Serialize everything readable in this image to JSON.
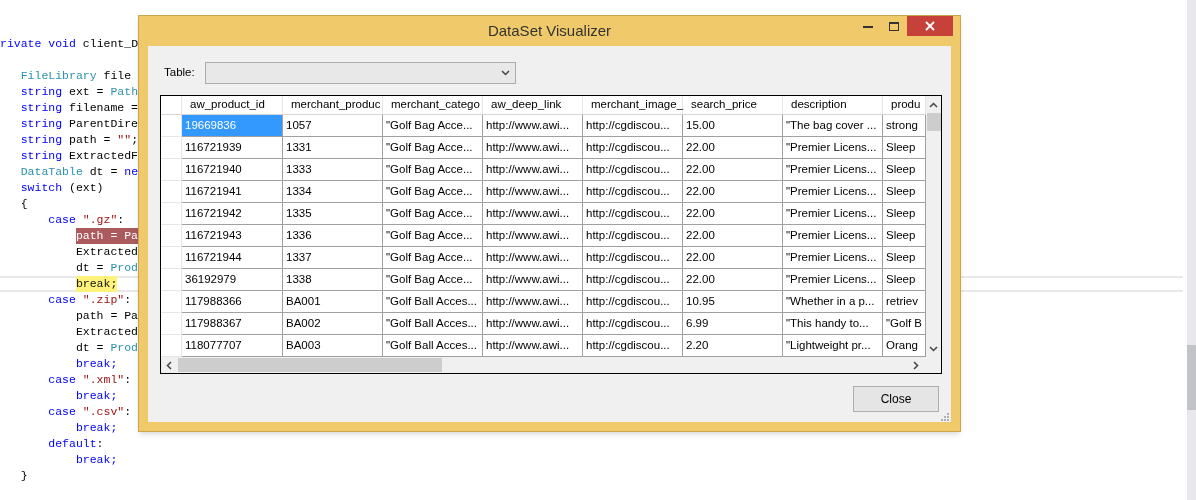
{
  "editor": {
    "lines": [
      {
        "tokens": [
          {
            "kind": "keyword",
            "text": "rivate void"
          },
          {
            "kind": "plain",
            "text": " client_D"
          }
        ],
        "children": [
          {
            "gap_before": true,
            "tokens": [
              {
                "kind": "type",
                "text": "FileLibrary"
              },
              {
                "kind": "plain",
                "text": " file"
              }
            ]
          },
          {
            "tokens": [
              {
                "kind": "keyword",
                "text": "string"
              },
              {
                "kind": "plain",
                "text": " ext = "
              },
              {
                "kind": "type",
                "text": "Path"
              }
            ]
          },
          {
            "tokens": [
              {
                "kind": "keyword",
                "text": "string"
              },
              {
                "kind": "plain",
                "text": " filename ="
              }
            ]
          },
          {
            "tokens": [
              {
                "kind": "keyword",
                "text": "string"
              },
              {
                "kind": "plain",
                "text": " ParentDire"
              }
            ]
          },
          {
            "tokens": [
              {
                "kind": "keyword",
                "text": "string"
              },
              {
                "kind": "plain",
                "text": " path = "
              },
              {
                "kind": "string",
                "text": "\"\""
              },
              {
                "kind": "plain",
                "text": ";"
              }
            ]
          },
          {
            "tokens": [
              {
                "kind": "keyword",
                "text": "string"
              },
              {
                "kind": "plain",
                "text": " ExtractedF"
              }
            ]
          },
          {
            "tokens": [
              {
                "kind": "type",
                "text": "DataTable"
              },
              {
                "kind": "plain",
                "text": " dt = "
              },
              {
                "kind": "keyword",
                "text": "ne"
              }
            ]
          },
          {
            "tokens": [
              {
                "kind": "keyword",
                "text": "switch"
              },
              {
                "kind": "plain",
                "text": " (ext)"
              }
            ]
          },
          {
            "tokens": [
              {
                "kind": "plain",
                "text": "{"
              }
            ],
            "children": [
              {
                "tokens": [
                  {
                    "kind": "keyword",
                    "text": "case"
                  },
                  {
                    "kind": "string",
                    "text": " \".gz\""
                  },
                  {
                    "kind": "plain",
                    "text": ":"
                  }
                ],
                "children": [
                  {
                    "breakpoint": true,
                    "tokens": [
                      {
                        "kind": "plain",
                        "text": "path = Pa"
                      }
                    ]
                  },
                  {
                    "tokens": [
                      {
                        "kind": "plain",
                        "text": "Extracted"
                      }
                    ]
                  },
                  {
                    "tokens": [
                      {
                        "kind": "plain",
                        "text": "dt = "
                      },
                      {
                        "kind": "type",
                        "text": "Prod"
                      }
                    ]
                  },
                  {
                    "current_statement": true,
                    "tokens": [
                      {
                        "kind": "keyword",
                        "text": "break;"
                      }
                    ]
                  }
                ]
              },
              {
                "tokens": [
                  {
                    "kind": "keyword",
                    "text": "case"
                  },
                  {
                    "kind": "string",
                    "text": " \".zip\""
                  },
                  {
                    "kind": "plain",
                    "text": ":"
                  }
                ],
                "children": [
                  {
                    "tokens": [
                      {
                        "kind": "plain",
                        "text": "path = Pa"
                      }
                    ]
                  },
                  {
                    "tokens": [
                      {
                        "kind": "plain",
                        "text": "Extracted"
                      }
                    ]
                  },
                  {
                    "tokens": [
                      {
                        "kind": "plain",
                        "text": "dt = "
                      },
                      {
                        "kind": "type",
                        "text": "Prod"
                      }
                    ]
                  },
                  {
                    "tokens": [
                      {
                        "kind": "keyword",
                        "text": "break;"
                      }
                    ]
                  }
                ]
              },
              {
                "tokens": [
                  {
                    "kind": "keyword",
                    "text": "case"
                  },
                  {
                    "kind": "string",
                    "text": " \".xml\""
                  },
                  {
                    "kind": "plain",
                    "text": ":"
                  }
                ],
                "children": [
                  {
                    "tokens": [
                      {
                        "kind": "keyword",
                        "text": "break;"
                      }
                    ]
                  }
                ]
              },
              {
                "tokens": [
                  {
                    "kind": "keyword",
                    "text": "case"
                  },
                  {
                    "kind": "string",
                    "text": " \".csv\""
                  },
                  {
                    "kind": "plain",
                    "text": ":"
                  }
                ],
                "children": [
                  {
                    "tokens": [
                      {
                        "kind": "keyword",
                        "text": "break;"
                      }
                    ]
                  }
                ]
              },
              {
                "tokens": [
                  {
                    "kind": "keyword",
                    "text": "default"
                  },
                  {
                    "kind": "plain",
                    "text": ":"
                  }
                ],
                "children": [
                  {
                    "tokens": [
                      {
                        "kind": "keyword",
                        "text": "break;"
                      }
                    ]
                  }
                ]
              }
            ]
          },
          {
            "tokens": [
              {
                "kind": "plain",
                "text": "}"
              }
            ]
          }
        ]
      }
    ]
  },
  "dialog": {
    "title": "DataSet Visualizer",
    "table_label": "Table:",
    "grid": {
      "columns": [
        "aw_product_id",
        "merchant_produc",
        "merchant_catego",
        "aw_deep_link",
        "merchant_image_",
        "search_price",
        "description",
        "produ"
      ],
      "rows": [
        {
          "cells": [
            {
              "text": "19669836",
              "selected": true
            },
            {
              "text": "1057",
              "selected": false
            },
            {
              "text": "\"Golf Bag Acce...",
              "selected": false
            },
            {
              "text": "http://www.awi...",
              "selected": false
            },
            {
              "text": "http://cgdiscou...",
              "selected": false
            },
            {
              "text": "15.00",
              "selected": false
            },
            {
              "text": "\"The bag cover ...",
              "selected": false
            },
            {
              "text": "strong",
              "selected": false
            }
          ]
        },
        {
          "cells": [
            {
              "text": "116721939",
              "selected": false
            },
            {
              "text": "1331",
              "selected": false
            },
            {
              "text": "\"Golf Bag Acce...",
              "selected": false
            },
            {
              "text": "http://www.awi...",
              "selected": false
            },
            {
              "text": "http://cgdiscou...",
              "selected": false
            },
            {
              "text": "22.00",
              "selected": false
            },
            {
              "text": "\"Premier Licens...",
              "selected": false
            },
            {
              "text": "Sleep",
              "selected": false
            }
          ]
        },
        {
          "cells": [
            {
              "text": "116721940",
              "selected": false
            },
            {
              "text": "1333",
              "selected": false
            },
            {
              "text": "\"Golf Bag Acce...",
              "selected": false
            },
            {
              "text": "http://www.awi...",
              "selected": false
            },
            {
              "text": "http://cgdiscou...",
              "selected": false
            },
            {
              "text": "22.00",
              "selected": false
            },
            {
              "text": "\"Premier Licens...",
              "selected": false
            },
            {
              "text": "Sleep",
              "selected": false
            }
          ]
        },
        {
          "cells": [
            {
              "text": "116721941",
              "selected": false
            },
            {
              "text": "1334",
              "selected": false
            },
            {
              "text": "\"Golf Bag Acce...",
              "selected": false
            },
            {
              "text": "http://www.awi...",
              "selected": false
            },
            {
              "text": "http://cgdiscou...",
              "selected": false
            },
            {
              "text": "22.00",
              "selected": false
            },
            {
              "text": "\"Premier Licens...",
              "selected": false
            },
            {
              "text": "Sleep",
              "selected": false
            }
          ]
        },
        {
          "cells": [
            {
              "text": "116721942",
              "selected": false
            },
            {
              "text": "1335",
              "selected": false
            },
            {
              "text": "\"Golf Bag Acce...",
              "selected": false
            },
            {
              "text": "http://www.awi...",
              "selected": false
            },
            {
              "text": "http://cgdiscou...",
              "selected": false
            },
            {
              "text": "22.00",
              "selected": false
            },
            {
              "text": "\"Premier Licens...",
              "selected": false
            },
            {
              "text": "Sleep",
              "selected": false
            }
          ]
        },
        {
          "cells": [
            {
              "text": "116721943",
              "selected": false
            },
            {
              "text": "1336",
              "selected": false
            },
            {
              "text": "\"Golf Bag Acce...",
              "selected": false
            },
            {
              "text": "http://www.awi...",
              "selected": false
            },
            {
              "text": "http://cgdiscou...",
              "selected": false
            },
            {
              "text": "22.00",
              "selected": false
            },
            {
              "text": "\"Premier Licens...",
              "selected": false
            },
            {
              "text": "Sleep",
              "selected": false
            }
          ]
        },
        {
          "cells": [
            {
              "text": "116721944",
              "selected": false
            },
            {
              "text": "1337",
              "selected": false
            },
            {
              "text": "\"Golf Bag Acce...",
              "selected": false
            },
            {
              "text": "http://www.awi...",
              "selected": false
            },
            {
              "text": "http://cgdiscou...",
              "selected": false
            },
            {
              "text": "22.00",
              "selected": false
            },
            {
              "text": "\"Premier Licens...",
              "selected": false
            },
            {
              "text": "Sleep",
              "selected": false
            }
          ]
        },
        {
          "cells": [
            {
              "text": "36192979",
              "selected": false
            },
            {
              "text": "1338",
              "selected": false
            },
            {
              "text": "\"Golf Bag Acce...",
              "selected": false
            },
            {
              "text": "http://www.awi...",
              "selected": false
            },
            {
              "text": "http://cgdiscou...",
              "selected": false
            },
            {
              "text": "22.00",
              "selected": false
            },
            {
              "text": "\"Premier Licens...",
              "selected": false
            },
            {
              "text": "Sleep",
              "selected": false
            }
          ]
        },
        {
          "cells": [
            {
              "text": "117988366",
              "selected": false
            },
            {
              "text": "BA001",
              "selected": false
            },
            {
              "text": "\"Golf Ball Acces...",
              "selected": false
            },
            {
              "text": "http://www.awi...",
              "selected": false
            },
            {
              "text": "http://cgdiscou...",
              "selected": false
            },
            {
              "text": "10.95",
              "selected": false
            },
            {
              "text": "\"Whether in a p...",
              "selected": false
            },
            {
              "text": "retriev",
              "selected": false
            }
          ]
        },
        {
          "cells": [
            {
              "text": "117988367",
              "selected": false
            },
            {
              "text": "BA002",
              "selected": false
            },
            {
              "text": "\"Golf Ball Acces...",
              "selected": false
            },
            {
              "text": "http://www.awi...",
              "selected": false
            },
            {
              "text": "http://cgdiscou...",
              "selected": false
            },
            {
              "text": "6.99",
              "selected": false
            },
            {
              "text": "\"This handy to...",
              "selected": false
            },
            {
              "text": "\"Golf B",
              "selected": false
            }
          ]
        },
        {
          "cells": [
            {
              "text": "118077707",
              "selected": false
            },
            {
              "text": "BA003",
              "selected": false
            },
            {
              "text": "\"Golf Ball Acces...",
              "selected": false
            },
            {
              "text": "http://www.awi...",
              "selected": false
            },
            {
              "text": "http://cgdiscou...",
              "selected": false
            },
            {
              "text": "2.20",
              "selected": false
            },
            {
              "text": "\"Lightweight pr...",
              "selected": false
            },
            {
              "text": "Orang",
              "selected": false
            }
          ]
        }
      ]
    },
    "close_button": "Close"
  }
}
